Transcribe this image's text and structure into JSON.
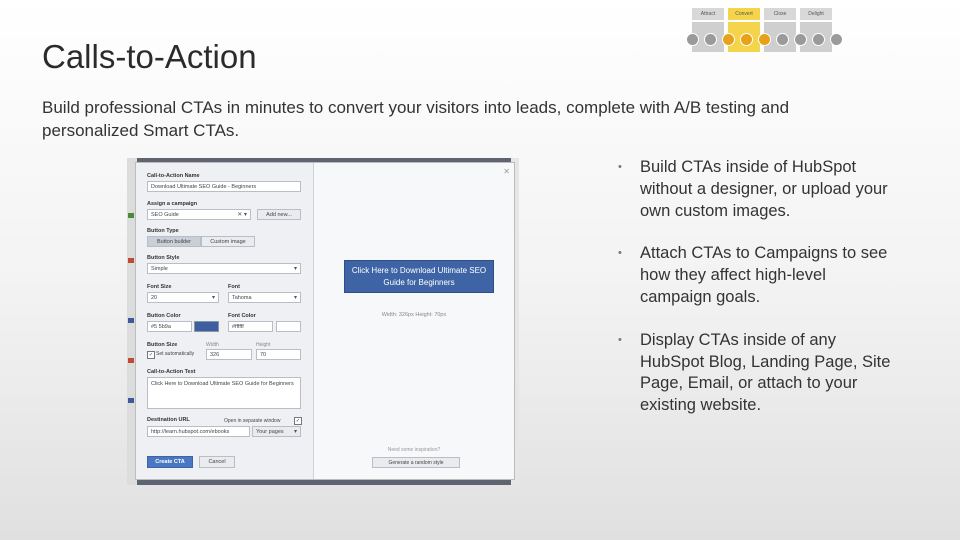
{
  "slide": {
    "title": "Calls-to-Action",
    "subtitle": "Build professional CTAs in minutes to convert your visitors into leads, complete with A/B testing and personalized Smart CTAs."
  },
  "funnel": {
    "stages": [
      "Attract",
      "Convert",
      "Close",
      "Delight"
    ],
    "active_stage": "Convert",
    "colors": {
      "active": "#f3d44a",
      "inactive": "#cfcfcf"
    }
  },
  "cta_editor": {
    "name_label": "Call-to-Action Name",
    "name_value": "Download Ultimate SEO Guide - Beginners",
    "campaign_label": "Assign a campaign",
    "campaign_value": "SEO Guide",
    "add_new_label": "Add new...",
    "button_type_label": "Button Type",
    "button_type_options": [
      "Button builder",
      "Custom image"
    ],
    "button_style_label": "Button Style",
    "button_style_value": "Simple",
    "font_size_label": "Font Size",
    "font_size_value": "20",
    "font_label": "Font",
    "font_value": "Tahoma",
    "button_color_label": "Button Color",
    "button_color_value": "#5 5b9a",
    "font_color_label": "Font Color",
    "font_color_value": "#ffffff",
    "button_size_label": "Button Size",
    "set_auto_label": "Set automatically",
    "width_label": "Width",
    "width_value": "326",
    "height_label": "Height",
    "height_value": "70",
    "cta_text_label": "Call-to-Action Text",
    "cta_text_value": "Click Here to Download Ultimate SEO Guide for Beginners",
    "dest_url_label": "Destination URL",
    "new_window_label": "Open in separate window",
    "dest_url_value": "http://learn.hubspot.com/ebooks",
    "your_pages_label": "Your pages",
    "create_label": "Create CTA",
    "cancel_label": "Cancel",
    "preview_button_text": "Click Here to Download Ultimate SEO Guide for Beginners",
    "preview_dimensions": "Width: 326px Height: 70px",
    "inspiration_text": "Need some inspiration?",
    "random_style_label": "Generate a random style",
    "colors": {
      "button": "#3e64a6",
      "primary": "#4a77c2"
    }
  },
  "bullets": [
    "Build CTAs inside of HubSpot without a designer, or upload your own custom images.",
    "Attach CTAs to Campaigns to see how they affect high-level campaign goals.",
    "Display CTAs inside of any HubSpot Blog, Landing Page, Site Page, Email, or attach to your existing website."
  ],
  "bullet_marker": "•"
}
